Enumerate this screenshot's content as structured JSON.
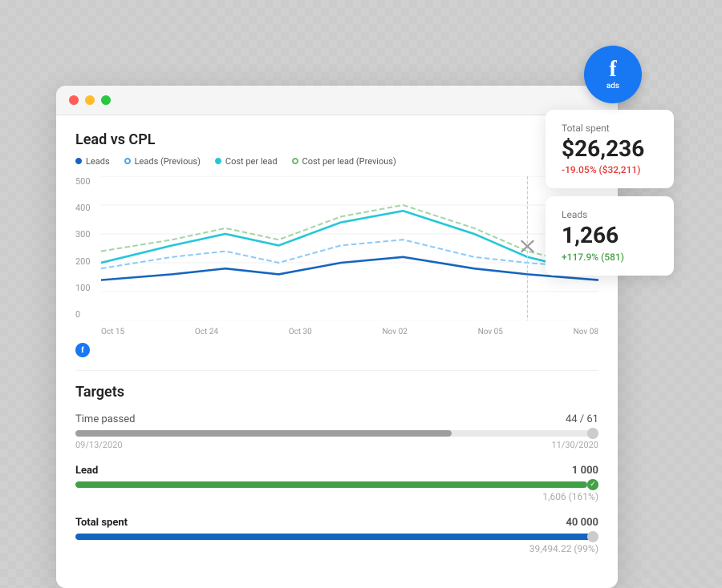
{
  "fbBadge": {
    "letter": "f",
    "label": "ads"
  },
  "browserWindow": {
    "trafficLights": [
      "red",
      "yellow",
      "green"
    ]
  },
  "chart": {
    "title": "Lead vs CPL",
    "legend": [
      {
        "label": "Leads",
        "color": "#1565C0",
        "dotColor": "#1565C0",
        "style": "solid"
      },
      {
        "label": "Leads (Previous)",
        "color": "#42A5F5",
        "dotColor": "#42A5F5",
        "style": "dashed"
      },
      {
        "label": "Cost per lead",
        "color": "#26C6DA",
        "dotColor": "#26C6DA",
        "style": "solid"
      },
      {
        "label": "Cost per lead (Previous)",
        "color": "#66BB6A",
        "dotColor": "#66BB6A",
        "style": "dashed"
      }
    ],
    "yLabels": [
      "500",
      "400",
      "300",
      "200",
      "100",
      "0"
    ],
    "xLabels": [
      "Oct 15",
      "Oct 24",
      "Oct 30",
      "Nov 02",
      "Nov 05",
      "Nov 08"
    ],
    "fbIconLetter": "f"
  },
  "statCards": {
    "totalSpent": {
      "label": "Total spent",
      "value": "$26,236",
      "change": "-19.05% ($32,211)",
      "changeType": "negative"
    },
    "leads": {
      "label": "Leads",
      "value": "1,266",
      "change": "+117.9% (581)",
      "changeType": "positive"
    }
  },
  "targets": {
    "title": "Targets",
    "rows": [
      {
        "name": "Time passed",
        "value": "44 / 61",
        "bold": false,
        "progress": 72,
        "barColor": "#9E9E9E",
        "dateStart": "09/13/2020",
        "dateEnd": "11/30/2020",
        "sub": null,
        "endDot": "plain"
      },
      {
        "name": "Lead",
        "value": "1 000",
        "bold": true,
        "progress": 100,
        "barColor": "#43A047",
        "dateStart": null,
        "dateEnd": null,
        "sub": "1,606 (161%)",
        "endDot": "check"
      },
      {
        "name": "Total spent",
        "value": "40 000",
        "bold": true,
        "progress": 99,
        "barColor": "#1565C0",
        "dateStart": null,
        "dateEnd": null,
        "sub": "39,494.22 (99%)",
        "endDot": "plain"
      }
    ]
  }
}
